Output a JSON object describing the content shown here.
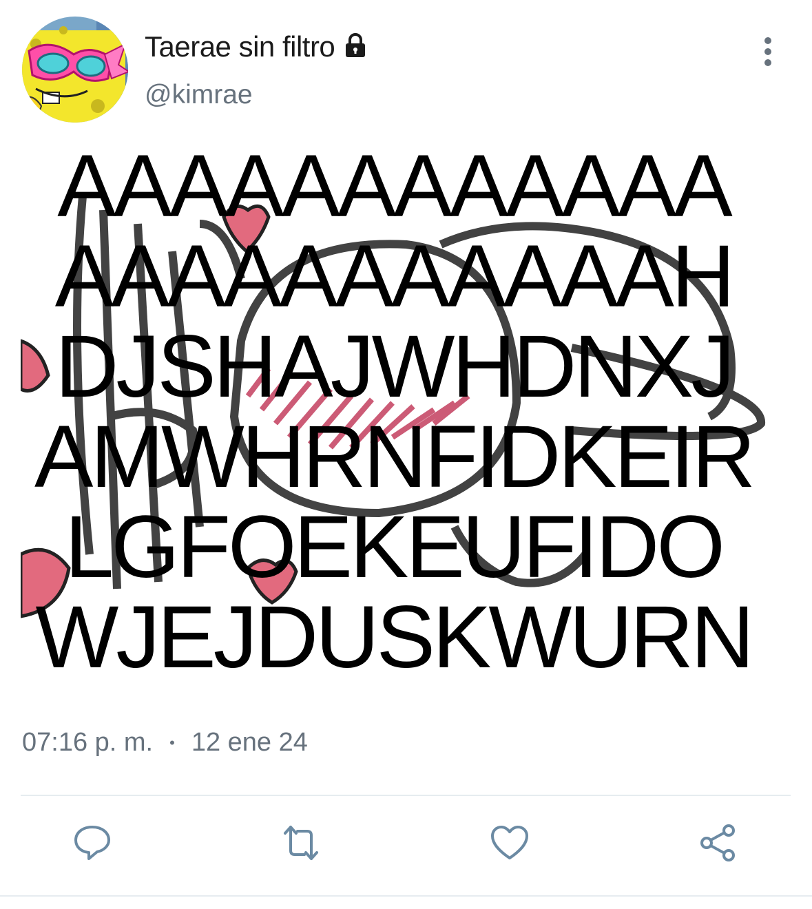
{
  "tweet": {
    "display_name": "Taerae sin filtro",
    "handle": "@kimrae",
    "time": "07:16 p. m.",
    "separator": "•",
    "date": "12 ene 24"
  },
  "media": {
    "caption_lines": [
      "AAAAAAAAAAAA",
      "AAAAAAAAAAAH",
      "DJSHAJWHDNXJ",
      "AMWHRNFIDKEIR",
      "LGFOEKEUFIDO",
      "WJEJDUSKWURN"
    ]
  },
  "icons": {
    "avatar": "spongebob-sunglasses-avatar",
    "lock": "lock-icon",
    "more": "more-vertical-icon",
    "reply": "reply-icon",
    "retweet": "retweet-icon",
    "like": "like-icon",
    "share": "share-icon"
  },
  "colors": {
    "accent": "#1da1f2",
    "icon": "#6b8aa3",
    "secondary_text": "#67727d"
  }
}
